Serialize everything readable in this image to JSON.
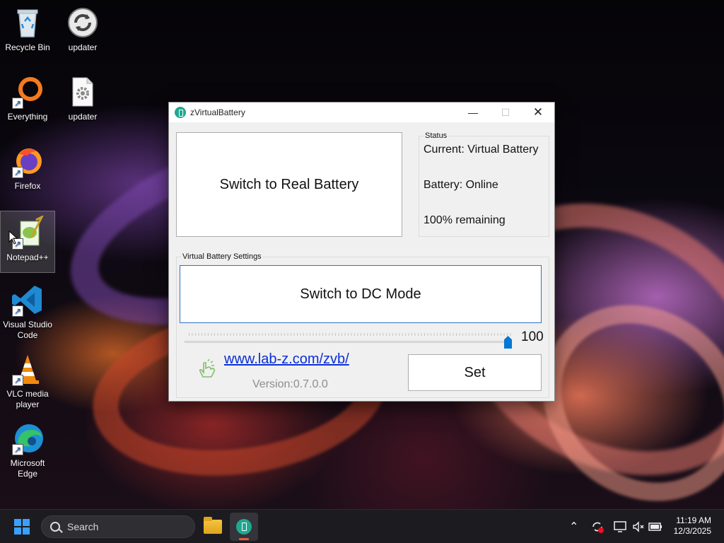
{
  "desktop": {
    "icons": [
      {
        "label": "Recycle Bin"
      },
      {
        "label": "updater"
      },
      {
        "label": "Everything"
      },
      {
        "label": "updater"
      },
      {
        "label": "Firefox"
      },
      {
        "label": "Notepad++"
      },
      {
        "label": "Visual Studio Code"
      },
      {
        "label": "VLC media player"
      },
      {
        "label": "Microsoft Edge"
      }
    ]
  },
  "window": {
    "title": "zVirtualBattery",
    "switch_real_label": "Switch to Real Battery",
    "status": {
      "group_title": "Status",
      "current": "Current: Virtual Battery",
      "battery": "Battery: Online",
      "remaining": "100% remaining"
    },
    "settings": {
      "group_title": "Virtual Battery Settings",
      "switch_dc_label": "Switch to DC Mode",
      "slider_value": "100",
      "slider_percent": 100,
      "link": "www.lab-z.com/zvb/",
      "version": "Version:0.7.0.0",
      "set_label": "Set"
    }
  },
  "taskbar": {
    "search_placeholder": "Search",
    "time": "11:19 AM",
    "date": "12/3/2025"
  },
  "colors": {
    "accent": "#0078d4",
    "link": "#0a2fd8",
    "app_icon": "#1fa88f"
  }
}
